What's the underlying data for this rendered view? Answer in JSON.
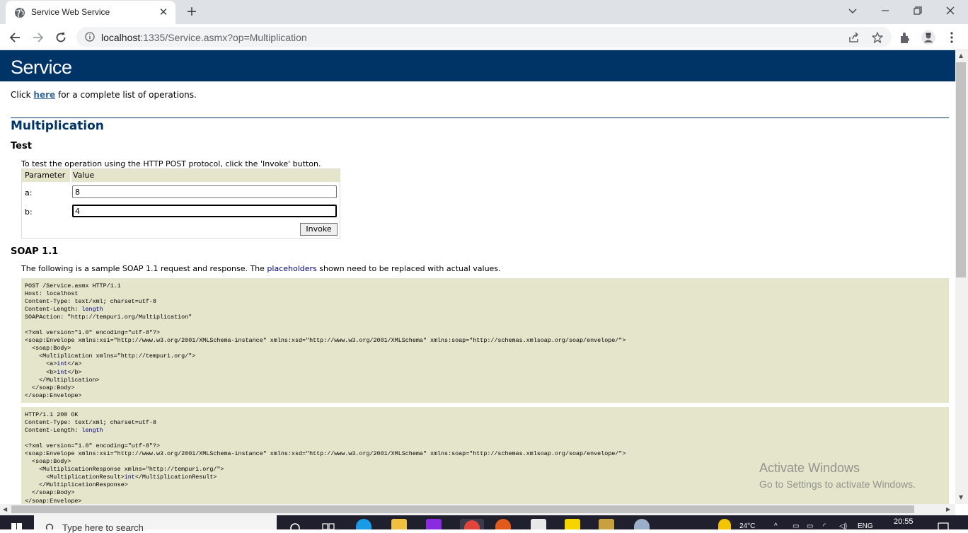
{
  "browser": {
    "tab_title": "Service Web Service",
    "url_host": "localhost",
    "url_rest": ":1335/Service.asmx?op=Multiplication"
  },
  "page": {
    "banner_title": "Service",
    "intro_before": "Click ",
    "intro_link": "here",
    "intro_after": " for a complete list of operations.",
    "operation_title": "Multiplication",
    "test_heading": "Test",
    "test_instructions": "To test the operation using the HTTP POST protocol, click the 'Invoke' button.",
    "form": {
      "col_parameter": "Parameter",
      "col_value": "Value",
      "param_a_label": "a:",
      "param_a_value": "8",
      "param_b_label": "b:",
      "param_b_value": "4",
      "invoke_label": "Invoke"
    },
    "soap11_heading": "SOAP 1.1",
    "soap11_desc_before": "The following is a sample SOAP 1.1 request and response. The ",
    "soap11_desc_link": "placeholders",
    "soap11_desc_after": " shown need to be replaced with actual values.",
    "request_lines": [
      [
        "POST /Service.asmx HTTP/1.1",
        ""
      ],
      [
        "Host: localhost",
        ""
      ],
      [
        "Content-Type: text/xml; charset=utf-8",
        ""
      ],
      [
        "Content-Length: ",
        "length"
      ],
      [
        "SOAPAction: \"http://tempuri.org/Multiplication\"",
        ""
      ],
      [
        "",
        ""
      ],
      [
        "<?xml version=\"1.0\" encoding=\"utf-8\"?>",
        ""
      ],
      [
        "<soap:Envelope xmlns:xsi=\"http://www.w3.org/2001/XMLSchema-instance\" xmlns:xsd=\"http://www.w3.org/2001/XMLSchema\" xmlns:soap=\"http://schemas.xmlsoap.org/soap/envelope/\">",
        ""
      ],
      [
        "  <soap:Body>",
        ""
      ],
      [
        "    <Multiplication xmlns=\"http://tempuri.org/\">",
        ""
      ],
      [
        "      <a>",
        "int",
        "</a>"
      ],
      [
        "      <b>",
        "int",
        "</b>"
      ],
      [
        "    </Multiplication>",
        ""
      ],
      [
        "  </soap:Body>",
        ""
      ],
      [
        "</soap:Envelope>",
        ""
      ]
    ],
    "response_lines": [
      [
        "HTTP/1.1 200 OK",
        ""
      ],
      [
        "Content-Type: text/xml; charset=utf-8",
        ""
      ],
      [
        "Content-Length: ",
        "length"
      ],
      [
        "",
        ""
      ],
      [
        "<?xml version=\"1.0\" encoding=\"utf-8\"?>",
        ""
      ],
      [
        "<soap:Envelope xmlns:xsi=\"http://www.w3.org/2001/XMLSchema-instance\" xmlns:xsd=\"http://www.w3.org/2001/XMLSchema\" xmlns:soap=\"http://schemas.xmlsoap.org/soap/envelope/\">",
        ""
      ],
      [
        "  <soap:Body>",
        ""
      ],
      [
        "    <MultiplicationResponse xmlns=\"http://tempuri.org/\">",
        ""
      ],
      [
        "      <MultiplicationResult>",
        "int",
        "</MultiplicationResult>"
      ],
      [
        "    </MultiplicationResponse>",
        ""
      ],
      [
        "  </soap:Body>",
        ""
      ],
      [
        "</soap:Envelope>",
        ""
      ]
    ]
  },
  "watermark": {
    "line1": "Activate Windows",
    "line2": "Go to Settings to activate Windows."
  },
  "taskbar": {
    "search_placeholder": "Type here to search",
    "weather": "24°C",
    "language": "ENG",
    "time": "20:55"
  },
  "colors": {
    "banner": "#003366",
    "code_bg": "#e5e5cc",
    "placeholder_blue": "#000080"
  }
}
